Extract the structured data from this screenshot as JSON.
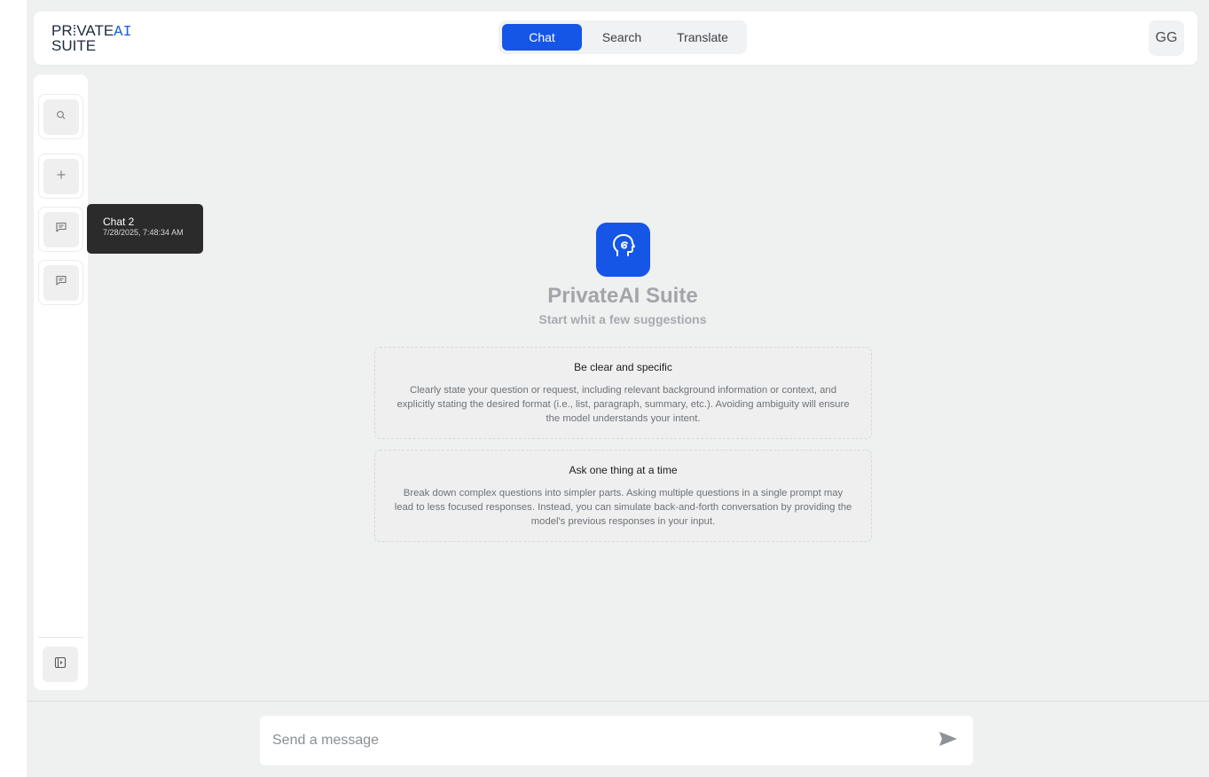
{
  "header": {
    "logo": {
      "line1_prefix": "PR",
      "line1_mark": "⁞",
      "line1_suffix": "VATE",
      "line1_ai": "AI",
      "line2": "SUITE"
    },
    "tabs": [
      {
        "label": "Chat",
        "active": true
      },
      {
        "label": "Search",
        "active": false
      },
      {
        "label": "Translate",
        "active": false
      }
    ],
    "avatar_initials": "GG"
  },
  "sidebar": {
    "items": [
      {
        "icon": "search-icon"
      },
      {
        "icon": "plus-icon"
      },
      {
        "icon": "chat-icon"
      },
      {
        "icon": "chat-icon"
      }
    ],
    "bottom_icon": "sidebar-toggle-icon"
  },
  "tooltip": {
    "title": "Chat 2",
    "date": "7/28/2025, 7:48:34 AM"
  },
  "main": {
    "brand_icon": "head-spiral-icon",
    "title": "PrivateAI Suite",
    "subtitle": "Start whit a few suggestions",
    "suggestions": [
      {
        "title": "Be clear and specific",
        "body": "Clearly state your question or request, including relevant background information or context, and explicitly stating the desired format (i.e., list, paragraph, summary, etc.). Avoiding ambiguity will ensure the model understands your intent."
      },
      {
        "title": "Ask one thing at a time",
        "body": "Break down complex questions into simpler parts. Asking multiple questions in a single prompt may lead to less focused responses. Instead, you can simulate back-and-forth conversation by providing the model's previous responses in your input."
      }
    ]
  },
  "composer": {
    "placeholder": "Send a message",
    "send_icon": "send-icon"
  },
  "colors": {
    "accent": "#1556e6",
    "background": "#eff0f0",
    "tooltip": "#2b2b2b"
  }
}
